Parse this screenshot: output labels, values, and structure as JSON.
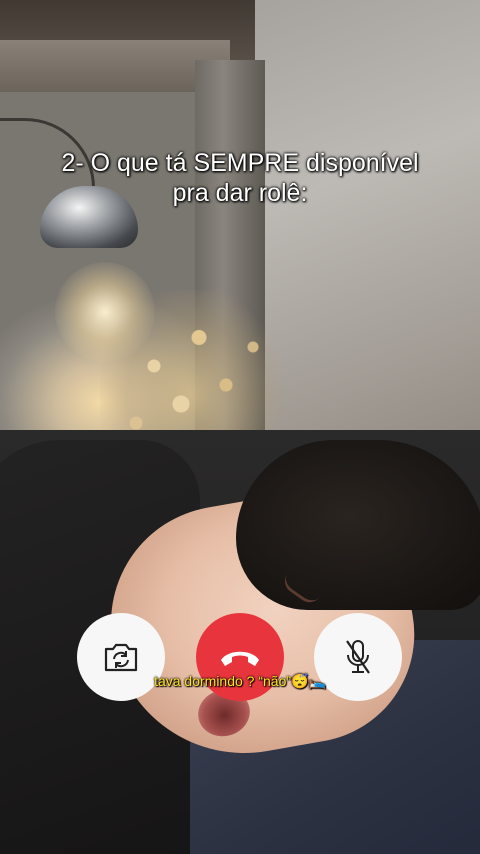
{
  "caption": {
    "line1": "2- O que tá SEMPRE disponível",
    "line2": "pra dar rolê:"
  },
  "call_controls": {
    "camera_icon": "camera-flip-icon",
    "end_icon": "phone-hangup-icon",
    "mute_icon": "microphone-muted-icon",
    "end_color": "#e8353d",
    "button_color": "#f7f7f7"
  },
  "subtitle": {
    "text": "tava dormindo ? “não”😴🛌"
  }
}
